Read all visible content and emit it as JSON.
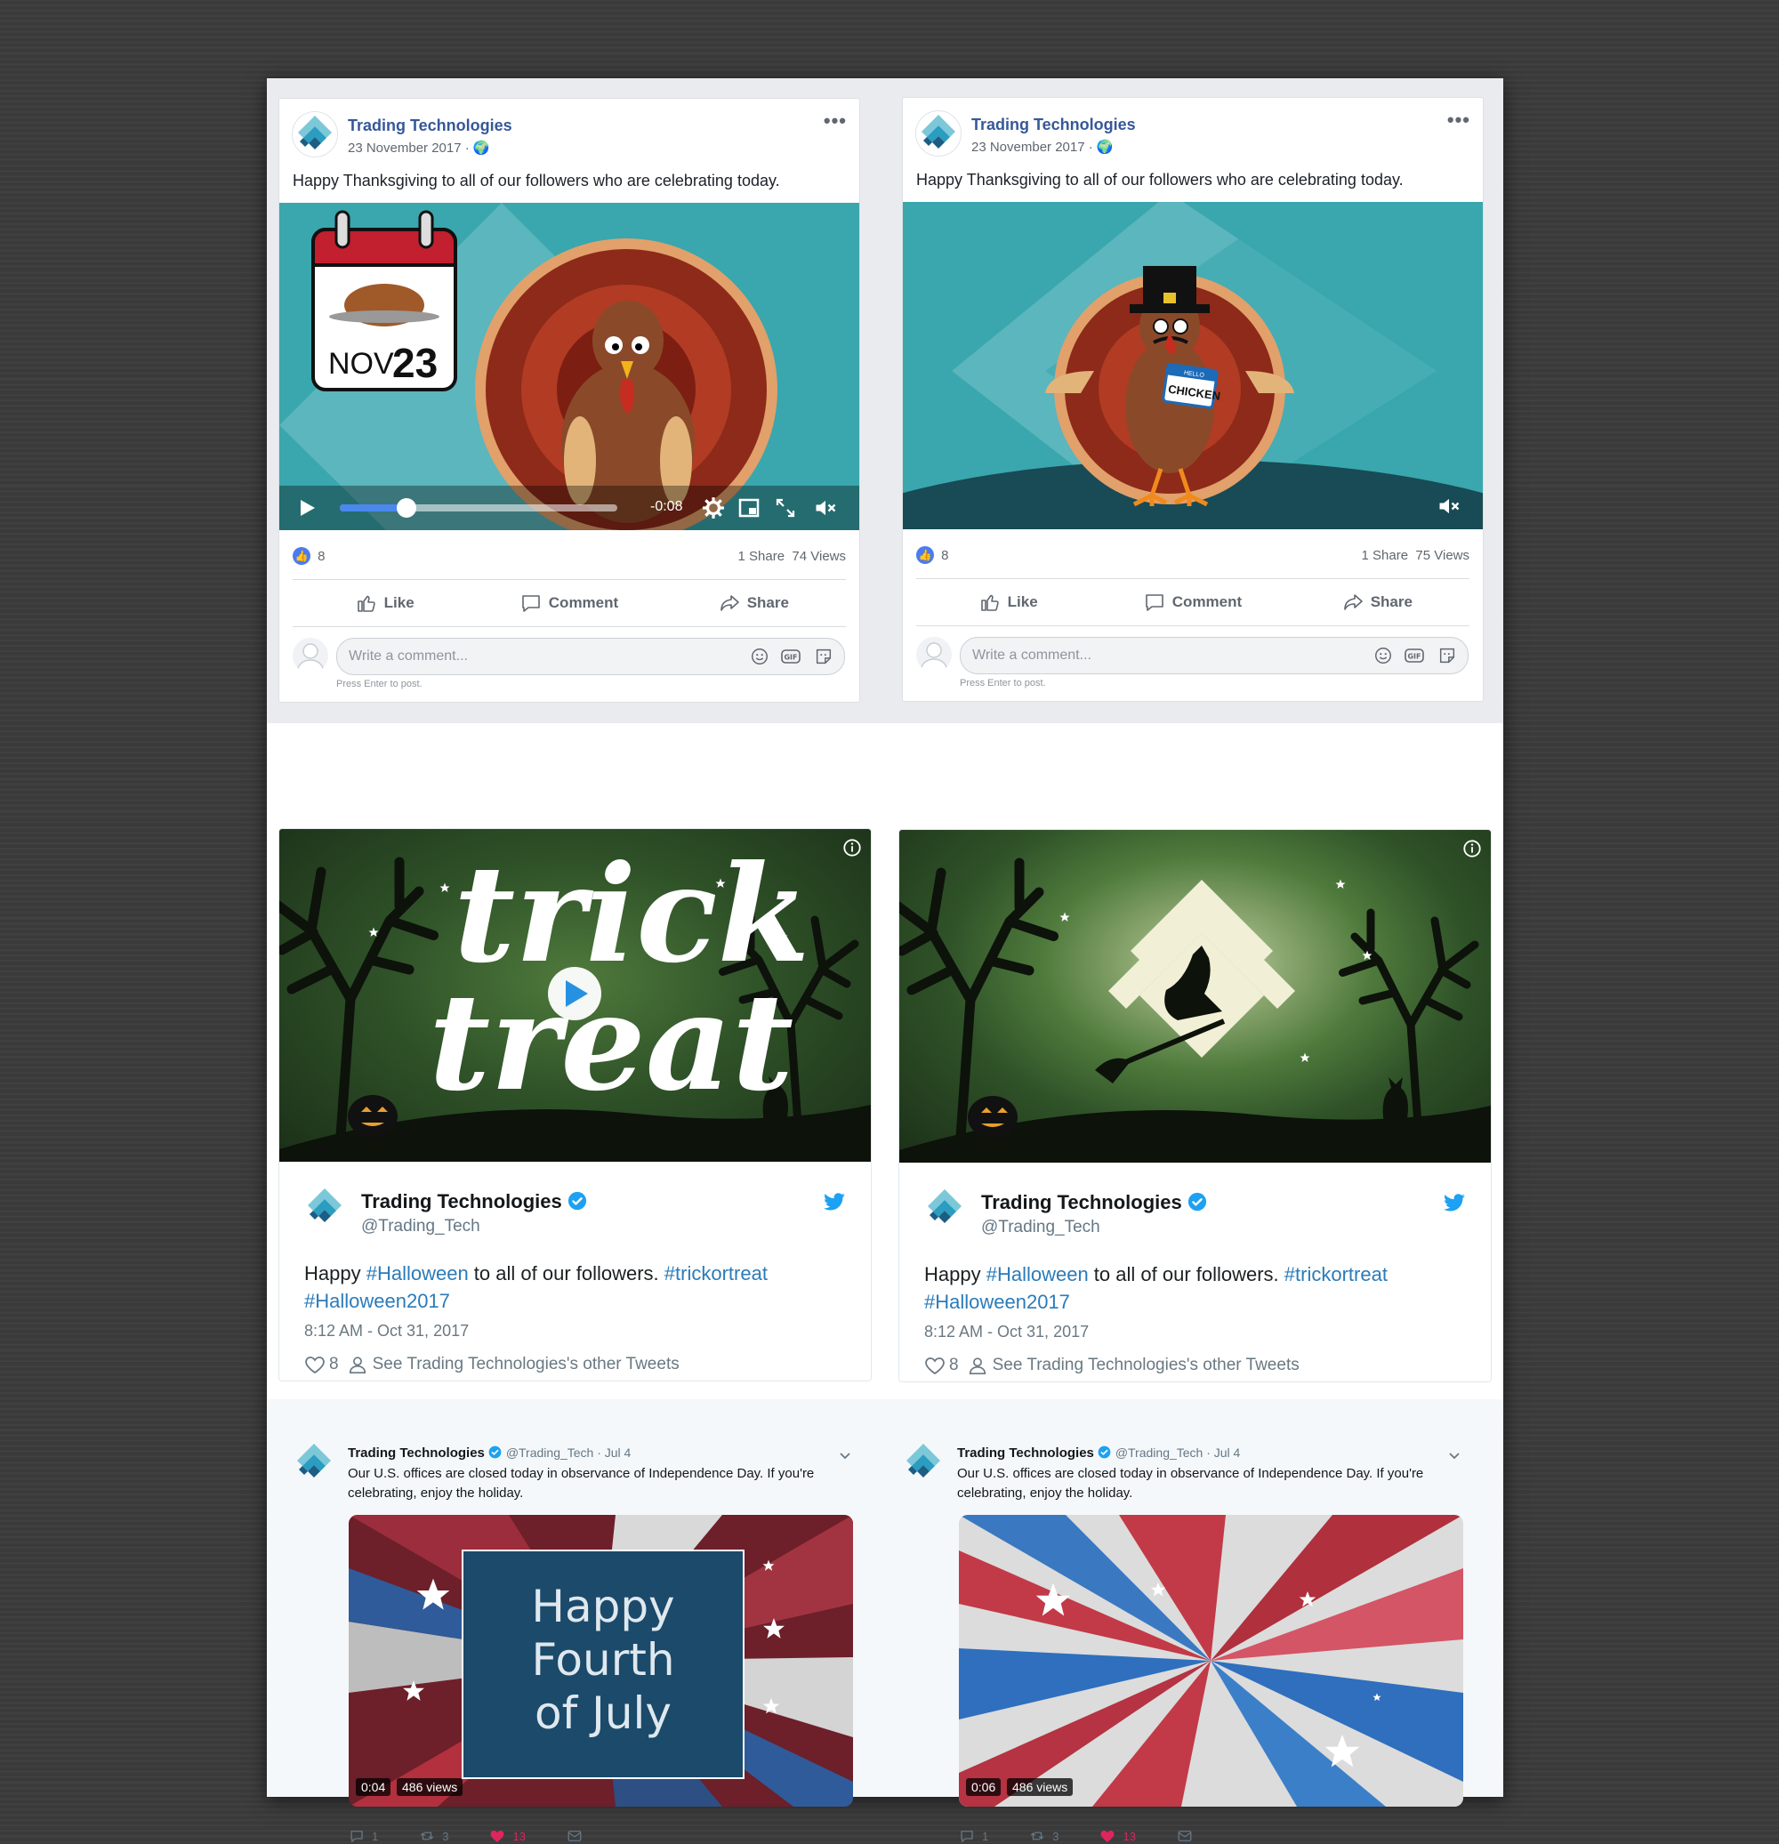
{
  "facebook_posts": [
    {
      "author": "Trading Technologies",
      "date": "23 November 2017 · 🌍",
      "text": "Happy Thanksgiving to all of our followers who are celebrating today.",
      "calendar_month": "NOV",
      "calendar_day": "23",
      "video_time": "-0:08",
      "video_progress": 0.24,
      "likes": "8",
      "shares": "1 Share",
      "views": "74 Views",
      "actions": {
        "like": "Like",
        "comment": "Comment",
        "share": "Share"
      },
      "comment_placeholder": "Write a comment...",
      "press_enter": "Press Enter to post."
    },
    {
      "author": "Trading Technologies",
      "date": "23 November 2017 · 🌍",
      "text": "Happy Thanksgiving to all of our followers who are celebrating today.",
      "name_tag_top": "HELLO",
      "name_tag": "CHICKEN",
      "likes": "8",
      "shares": "1 Share",
      "views": "75 Views",
      "actions": {
        "like": "Like",
        "comment": "Comment",
        "share": "Share"
      },
      "comment_placeholder": "Write a comment...",
      "press_enter": "Press Enter to post."
    }
  ],
  "halloween_tweets": [
    {
      "title_art_1": "trick",
      "title_art_2": "treat",
      "name": "Trading Technologies",
      "handle": "@Trading_Tech",
      "text_1": "Happy ",
      "hashtag_1": "#Halloween",
      "text_2": " to all of our followers. ",
      "hashtag_2": "#trickortreat",
      "hashtag_3": "#Halloween2017",
      "time": "8:12 AM - Oct 31, 2017",
      "likes": "8",
      "other": "See Trading Technologies's other Tweets"
    },
    {
      "name": "Trading Technologies",
      "handle": "@Trading_Tech",
      "text_1": "Happy ",
      "hashtag_1": "#Halloween",
      "text_2": " to all of our followers. ",
      "hashtag_2": "#trickortreat",
      "hashtag_3": "#Halloween2017",
      "time": "8:12 AM - Oct 31, 2017",
      "likes": "8",
      "other": "See Trading Technologies's other Tweets"
    }
  ],
  "july_tweets": [
    {
      "name": "Trading Technologies",
      "meta": "@Trading_Tech · Jul 4",
      "text": "Our U.S. offices are closed today in observance of Independence Day. If you're celebrating, enjoy the holiday.",
      "video_title_1": "Happy",
      "video_title_2": "Fourth",
      "video_title_3": "of July",
      "duration": "0:04",
      "views": "486 views",
      "replies": "1",
      "retweets": "3",
      "likes": "13"
    },
    {
      "name": "Trading Technologies",
      "meta": "@Trading_Tech · Jul 4",
      "text": "Our U.S. offices are closed today in observance of Independence Day. If you're celebrating, enjoy the holiday.",
      "duration": "0:06",
      "views": "486 views",
      "replies": "1",
      "retweets": "3",
      "likes": "13"
    }
  ],
  "colors": {
    "facebook_blue": "#365899",
    "twitter_blue": "#1da1f2",
    "like_red": "#e0245e",
    "teal": "#3ba3ab"
  }
}
